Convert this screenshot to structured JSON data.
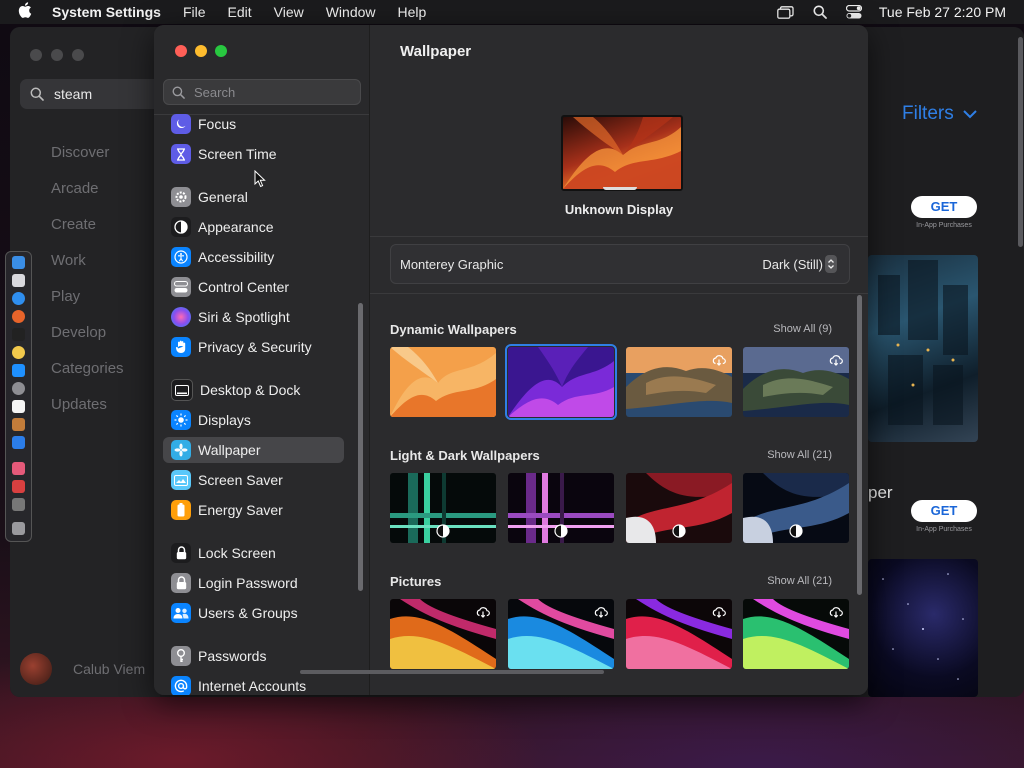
{
  "menubar": {
    "app_name": "System Settings",
    "menus": [
      "File",
      "Edit",
      "View",
      "Window",
      "Help"
    ],
    "clock": "Tue Feb 27  2:20 PM"
  },
  "appstore": {
    "search_value": "steam",
    "nav": [
      "Discover",
      "Arcade",
      "Create",
      "Work",
      "Play",
      "Develop",
      "Categories",
      "Updates"
    ],
    "user_name": "Calub Viem",
    "filters_label": "Filters",
    "get_label": "GET",
    "in_app_label": "In-App Purchases",
    "text_fragment": "per"
  },
  "settings": {
    "search_placeholder": "Search",
    "sidebar": [
      {
        "label": "Focus",
        "icon": "moon-icon",
        "color": "#5e5ce6"
      },
      {
        "label": "Screen Time",
        "icon": "hourglass-icon",
        "color": "#5e5ce6"
      },
      {
        "label": "General",
        "icon": "gear-icon",
        "color": "#8e8e93"
      },
      {
        "label": "Appearance",
        "icon": "appearance-icon",
        "color": "#1c1c1e"
      },
      {
        "label": "Accessibility",
        "icon": "accessibility-icon",
        "color": "#0a84ff"
      },
      {
        "label": "Control Center",
        "icon": "control-center-icon",
        "color": "#8e8e93"
      },
      {
        "label": "Siri & Spotlight",
        "icon": "siri-icon",
        "color": "#bf5af2"
      },
      {
        "label": "Privacy & Security",
        "icon": "hand-icon",
        "color": "#0a84ff"
      },
      {
        "label": "Desktop & Dock",
        "icon": "dock-icon",
        "color": "#1c1c1e"
      },
      {
        "label": "Displays",
        "icon": "sun-icon",
        "color": "#0a84ff"
      },
      {
        "label": "Wallpaper",
        "icon": "wallpaper-icon",
        "color": "#32ade6"
      },
      {
        "label": "Screen Saver",
        "icon": "screen-saver-icon",
        "color": "#5ac8fa"
      },
      {
        "label": "Energy Saver",
        "icon": "battery-icon",
        "color": "#ff9f0a"
      },
      {
        "label": "Lock Screen",
        "icon": "lock-icon",
        "color": "#1c1c1e"
      },
      {
        "label": "Login Password",
        "icon": "login-lock-icon",
        "color": "#8e8e93"
      },
      {
        "label": "Users & Groups",
        "icon": "users-icon",
        "color": "#0a84ff"
      },
      {
        "label": "Passwords",
        "icon": "key-icon",
        "color": "#8e8e93"
      },
      {
        "label": "Internet Accounts",
        "icon": "at-icon",
        "color": "#0a84ff"
      }
    ],
    "selected_item": "Wallpaper",
    "title": "Wallpaper",
    "display_name": "Unknown Display",
    "current_wallpaper": "Monterey Graphic",
    "appearance_mode": "Dark (Still)",
    "sections": [
      {
        "title": "Dynamic Wallpapers",
        "show_all": "Show All (9)"
      },
      {
        "title": "Light & Dark Wallpapers",
        "show_all": "Show All (21)"
      },
      {
        "title": "Pictures",
        "show_all": "Show All (21)"
      }
    ]
  },
  "colors": {
    "accent": "#2f7fe6",
    "close": "#ff5f57",
    "minimize": "#febc2e",
    "zoom": "#28c840"
  }
}
